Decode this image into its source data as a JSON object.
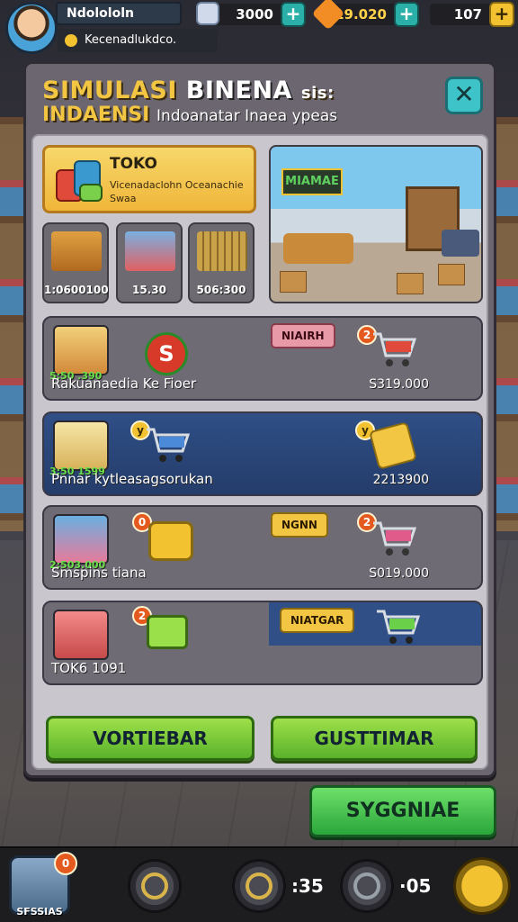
{
  "hud": {
    "player_name": "Ndolololn",
    "player_status": "Kecenadlukdco.",
    "resource_1": "3000",
    "resource_2": "19.020",
    "resource_3": "107",
    "plus_symbol": "+"
  },
  "panel": {
    "title_line1_a": "SIMULASI",
    "title_line1_b": "BINENA",
    "title_line1_c": "sis:",
    "title_line2_a": "INDAENSI",
    "title_line2_b": "Indoanatar Inaea ypeas",
    "close_symbol": "✕"
  },
  "toko": {
    "title": "TOKO",
    "description": "Vicenadaclohn Oceanachie Swaa"
  },
  "minis": [
    {
      "value": "1:0600100"
    },
    {
      "value": "15.30"
    },
    {
      "value": "506:300"
    }
  ],
  "scene": {
    "sign": "MIAMAE"
  },
  "rows": [
    {
      "thumb_value": "5:50 .390",
      "name": "Rakuanaedia Ke Fioer",
      "price": "S319.000",
      "tag": "NIAIRH",
      "badge": "2"
    },
    {
      "thumb_value": "3:50 1599",
      "name": "Pnnar kytleasagsorukan",
      "price": "2213900",
      "badge_left": "y",
      "badge_right": "y"
    },
    {
      "thumb_value": "2:503.000",
      "name": "Smspins tiana",
      "price": "S019.000",
      "tag": "NGNN",
      "badge_left": "0",
      "badge_right": "2"
    },
    {
      "name": "TOK6 1091",
      "tag": "NIATGAR",
      "badge_left": "2"
    }
  ],
  "buttons": {
    "left": "VORTIEBAR",
    "right": "GUSTTIMAR",
    "big": "SYGGNIAE"
  },
  "nav": {
    "home_label": "SFSSIAS",
    "home_badge": "0",
    "timer_1": ":35",
    "timer_2": "·05"
  },
  "colors": {
    "accent_gold": "#f2c542",
    "accent_green": "#5ab22a",
    "row_blue": "#2f4f86",
    "close_teal": "#3ec3c9"
  }
}
